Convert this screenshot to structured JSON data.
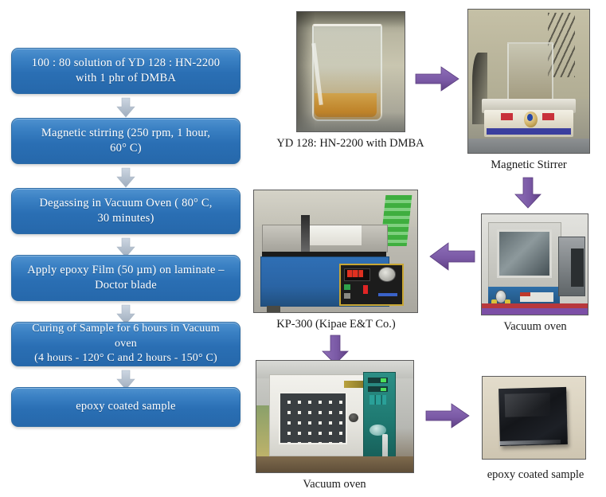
{
  "flowchart": {
    "steps": [
      {
        "id": "step-1",
        "lines": [
          "100 : 80 solution  of YD 128 : HN-2200",
          "with  1 phr  of DMBA"
        ]
      },
      {
        "id": "step-2",
        "lines": [
          "Magnetic  stirring  (250 rpm,  1 hour,",
          "60° C)"
        ]
      },
      {
        "id": "step-3",
        "lines": [
          "Degassing  in  Vacuum  Oven ( 80° C,",
          "30 minutes)"
        ]
      },
      {
        "id": "step-4",
        "lines": [
          "Apply  epoxy  Film  (50 µm)  on laminate –",
          "Doctor blade"
        ]
      },
      {
        "id": "step-5",
        "lines": [
          "Curing of Sample for 6 hours in Vacuum oven",
          "(4 hours - 120° C and 2 hours - 150° C)"
        ]
      },
      {
        "id": "step-6",
        "lines": [
          "epoxy  coated  sample"
        ]
      }
    ],
    "connector_icon": "arrow-down-icon"
  },
  "photos": [
    {
      "id": "photo-beaker",
      "caption": "YD 128: HN-2200 with DMBA",
      "alt": "beaker-with-amber-resin-photo"
    },
    {
      "id": "photo-magnetic-stirrer",
      "caption": "Magnetic Stirrer",
      "alt": "magnetic-stirrer-photo"
    },
    {
      "id": "photo-vacuum-oven-small",
      "caption": "Vacuum oven",
      "alt": "small-vacuum-oven-photo"
    },
    {
      "id": "photo-kp300",
      "caption": "KP-300 (Kipae E&T Co.)",
      "alt": "film-applicator-coater-photo"
    },
    {
      "id": "photo-vacuum-oven-large",
      "caption": "Vacuum oven",
      "alt": "large-vacuum-oven-photo"
    },
    {
      "id": "photo-epoxy-sample",
      "caption": "epoxy coated sample",
      "alt": "black-epoxy-coated-laminate-photo"
    }
  ],
  "arrows": [
    {
      "id": "arrow-beaker-to-stirrer",
      "direction": "right",
      "icon": "arrow-right-icon"
    },
    {
      "id": "arrow-stirrer-to-oven",
      "direction": "down",
      "icon": "arrow-down-icon"
    },
    {
      "id": "arrow-oven-to-kp300",
      "direction": "left",
      "icon": "arrow-left-icon"
    },
    {
      "id": "arrow-kp300-to-bigoven",
      "direction": "down",
      "icon": "arrow-down-icon"
    },
    {
      "id": "arrow-bigoven-to-sample",
      "direction": "right",
      "icon": "arrow-right-icon"
    }
  ],
  "colors": {
    "box_fill_light": "#4f92cf",
    "box_fill_dark": "#2668ab",
    "box_text": "#ffffff",
    "grey_arrow": "#b0bcca",
    "purple_arrow": "#7b5aa6",
    "caption_text": "#1a1a1a",
    "background": "#ffffff"
  }
}
